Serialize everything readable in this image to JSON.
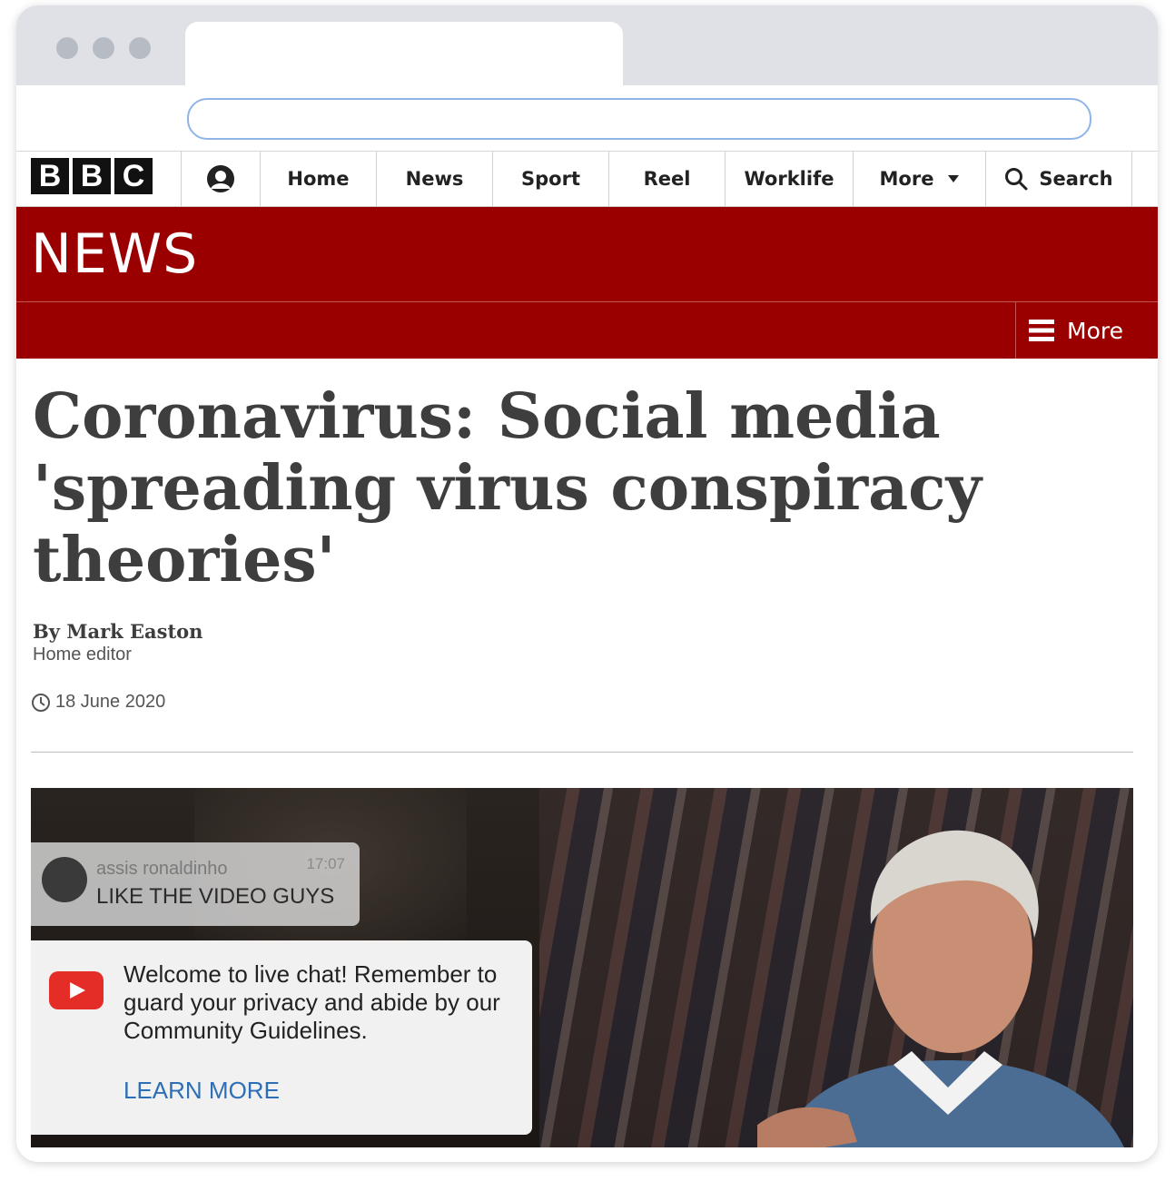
{
  "browser": {
    "address_value": ""
  },
  "bbc_nav": {
    "logo_letters": [
      "B",
      "B",
      "C"
    ],
    "items": [
      {
        "label": "Home"
      },
      {
        "label": "News"
      },
      {
        "label": "Sport"
      },
      {
        "label": "Reel"
      },
      {
        "label": "Worklife"
      },
      {
        "label": "More"
      },
      {
        "label": "Search"
      }
    ]
  },
  "news_band": {
    "wordmark": "NEWS",
    "more_label": "More"
  },
  "article": {
    "headline": "Coronavirus: Social media 'spreading virus conspiracy theories'",
    "byline": "By Mark Easton",
    "role": "Home editor",
    "date": "18 June 2020"
  },
  "media": {
    "chat_user": "assis ronaldinho",
    "chat_time": "17:07",
    "chat_message": "LIKE THE VIDEO GUYS",
    "notice": "Welcome to live chat! Remember to guard your privacy and abide by our Community Guidelines.",
    "learn_more": "LEARN MORE"
  },
  "colors": {
    "bbc_red": "#9a0000",
    "link_blue": "#2c6fb7",
    "youtube_red": "#e52d27"
  }
}
